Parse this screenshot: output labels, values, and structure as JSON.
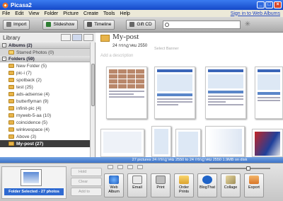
{
  "window": {
    "title": "Picasa2"
  },
  "menu": {
    "items": [
      "File",
      "Edit",
      "View",
      "Folder",
      "Picture",
      "Create",
      "Tools",
      "Help"
    ],
    "signin": "Sign in to Web Albums"
  },
  "toolbar": {
    "import": "Import",
    "slideshow": "Slideshow",
    "timeline": "Timeline",
    "giftcd": "Gift CD"
  },
  "library": {
    "title": "Library",
    "albums_label": "Albums (2)",
    "starred": "Starred Photos (0)",
    "folders_label": "Folders (59)",
    "folders": [
      "New Folder (5)",
      "pic-i (7)",
      "spotback (2)",
      "test (25)",
      "ads-adsense (4)",
      "butterflyman (9)",
      "infinit-pic (4)",
      "myweb-5-aa (10)",
      "coincidence (5)",
      "winkvespace (4)",
      "Above (3)",
      "My-post (27)"
    ]
  },
  "album": {
    "title": "My-post",
    "date": "24 กรกฎาคม 2550",
    "selected_note": "Select Banner",
    "description": "Add a description"
  },
  "status": {
    "text": "27 pictures  24 กรกฎาคม 2550 to 24 กรกฎาคม 2550  1.9MB on disk"
  },
  "tray": {
    "label": "Folder Selected - 27 photos"
  },
  "side_actions": {
    "hold": "Hold",
    "clear": "Clear",
    "add": "Add to"
  },
  "actions": [
    "Web Album",
    "Email",
    "Print",
    "Order Prints",
    "BlogThat",
    "Collage",
    "Export"
  ],
  "colors": {
    "title_bar": "#1549c8",
    "status_bar": "#3d73c8",
    "folder_selected": "#3c3c3c"
  }
}
